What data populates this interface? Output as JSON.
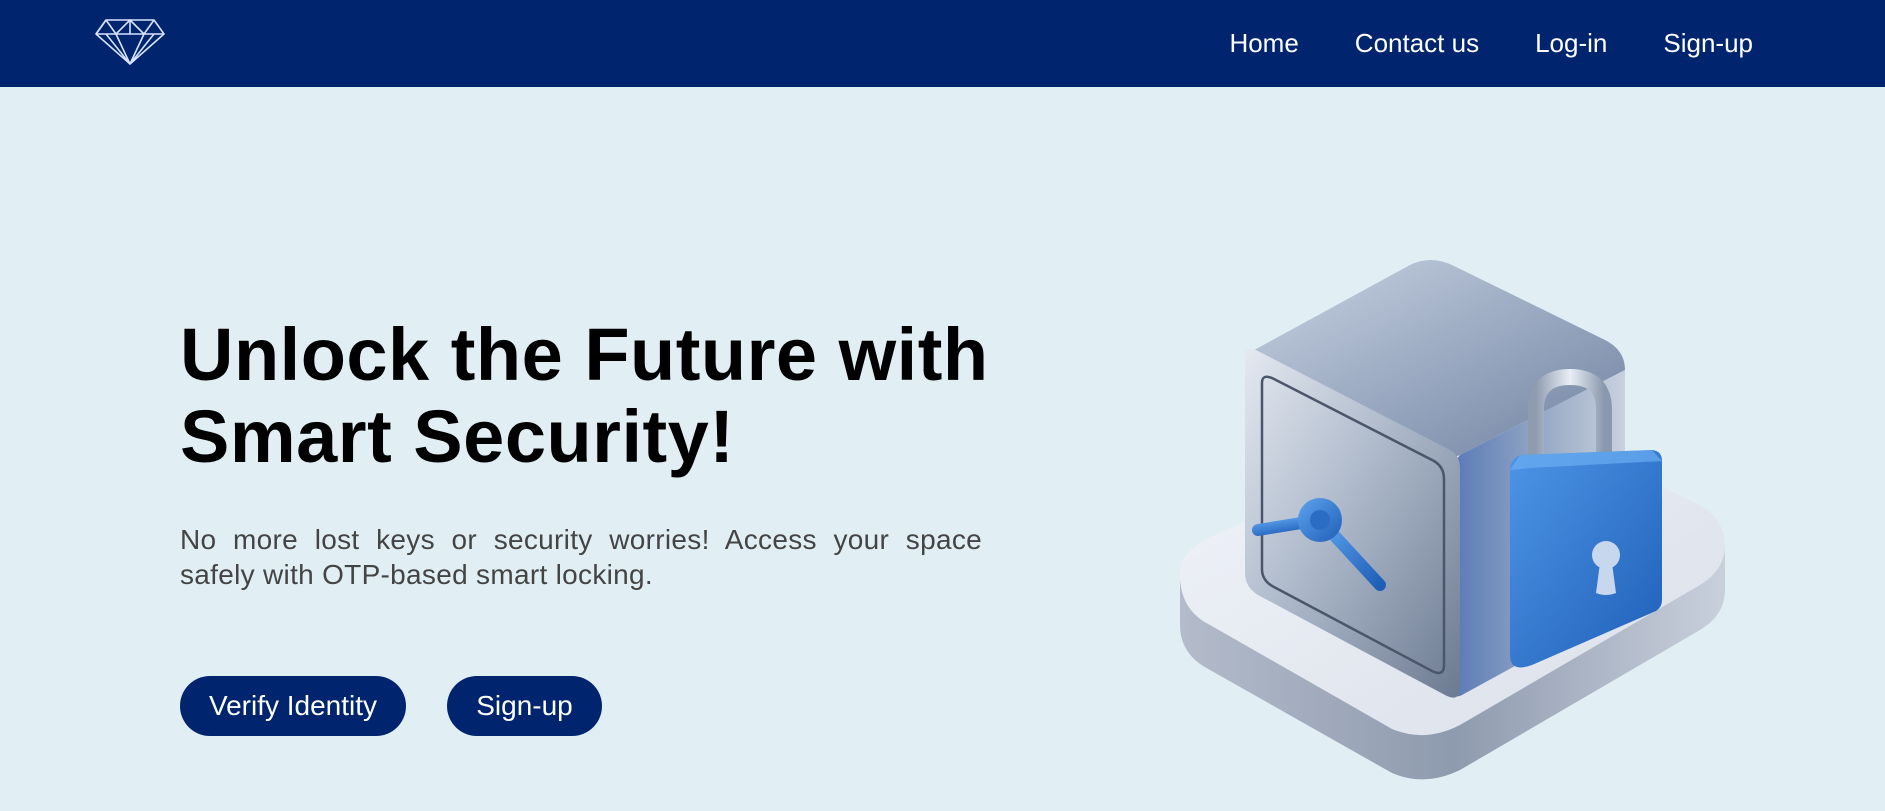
{
  "nav": {
    "logo_icon": "diamond-icon",
    "links": [
      {
        "label": "Home"
      },
      {
        "label": "Contact us"
      },
      {
        "label": "Log-in"
      },
      {
        "label": "Sign-up"
      }
    ]
  },
  "hero": {
    "title_line1": "Unlock the Future with",
    "title_line2": "Smart Security!",
    "subtitle": "No more lost keys or security worries! Access your space safely with OTP-based smart locking.",
    "verify_button": "Verify Identity",
    "signup_button": "Sign-up",
    "illustration_icon": "safe-with-padlock-icon"
  },
  "colors": {
    "nav_background": "#00246d",
    "page_background": "#e1eff4",
    "button_background": "#00246d",
    "accent_blue": "#3a7fd0"
  }
}
